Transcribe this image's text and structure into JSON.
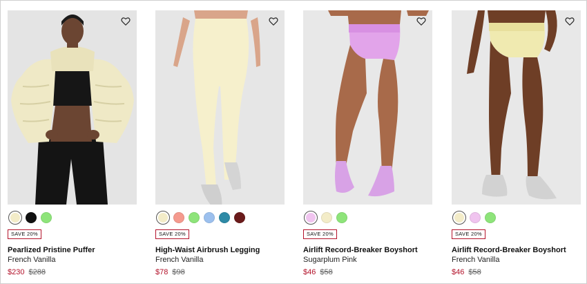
{
  "products": [
    {
      "name": "Pearlized Pristine Puffer",
      "color": "French Vanilla",
      "sale_price": "$230",
      "original_price": "$288",
      "badge": "SAVE 20%",
      "image_bg": "#e4e4e4",
      "swatches": [
        "#f3ecc8",
        "#111111",
        "#8ee47a"
      ],
      "selected_swatch": 0,
      "wishlist_icon": "heart-outline-icon"
    },
    {
      "name": "High-Waist Airbrush Legging",
      "color": "French Vanilla",
      "sale_price": "$78",
      "original_price": "$98",
      "badge": "SAVE 20%",
      "image_bg": "#e6e6e6",
      "swatches": [
        "#f3ecc8",
        "#f59a8e",
        "#8ee47a",
        "#9cc0ee",
        "#2e8aa6",
        "#6a1b1b"
      ],
      "selected_swatch": 0,
      "wishlist_icon": "heart-outline-icon"
    },
    {
      "name": "Airlift Record-Breaker Boyshort",
      "color": "Sugarplum Pink",
      "sale_price": "$46",
      "original_price": "$58",
      "badge": "SAVE 20%",
      "image_bg": "#e8e8e8",
      "swatches": [
        "#f0c4ef",
        "#f3ecc8",
        "#8ee47a"
      ],
      "selected_swatch": 0,
      "wishlist_icon": "heart-outline-icon"
    },
    {
      "name": "Airlift Record-Breaker Boyshort",
      "color": "French Vanilla",
      "sale_price": "$46",
      "original_price": "$58",
      "badge": "SAVE 20%",
      "image_bg": "#e8e8e8",
      "swatches": [
        "#f3ecc8",
        "#f0c4ef",
        "#8ee47a"
      ],
      "selected_swatch": 0,
      "wishlist_icon": "heart-outline-icon"
    }
  ],
  "colors": {
    "sale_red": "#b3122a",
    "text": "#111111",
    "muted": "#666666"
  }
}
